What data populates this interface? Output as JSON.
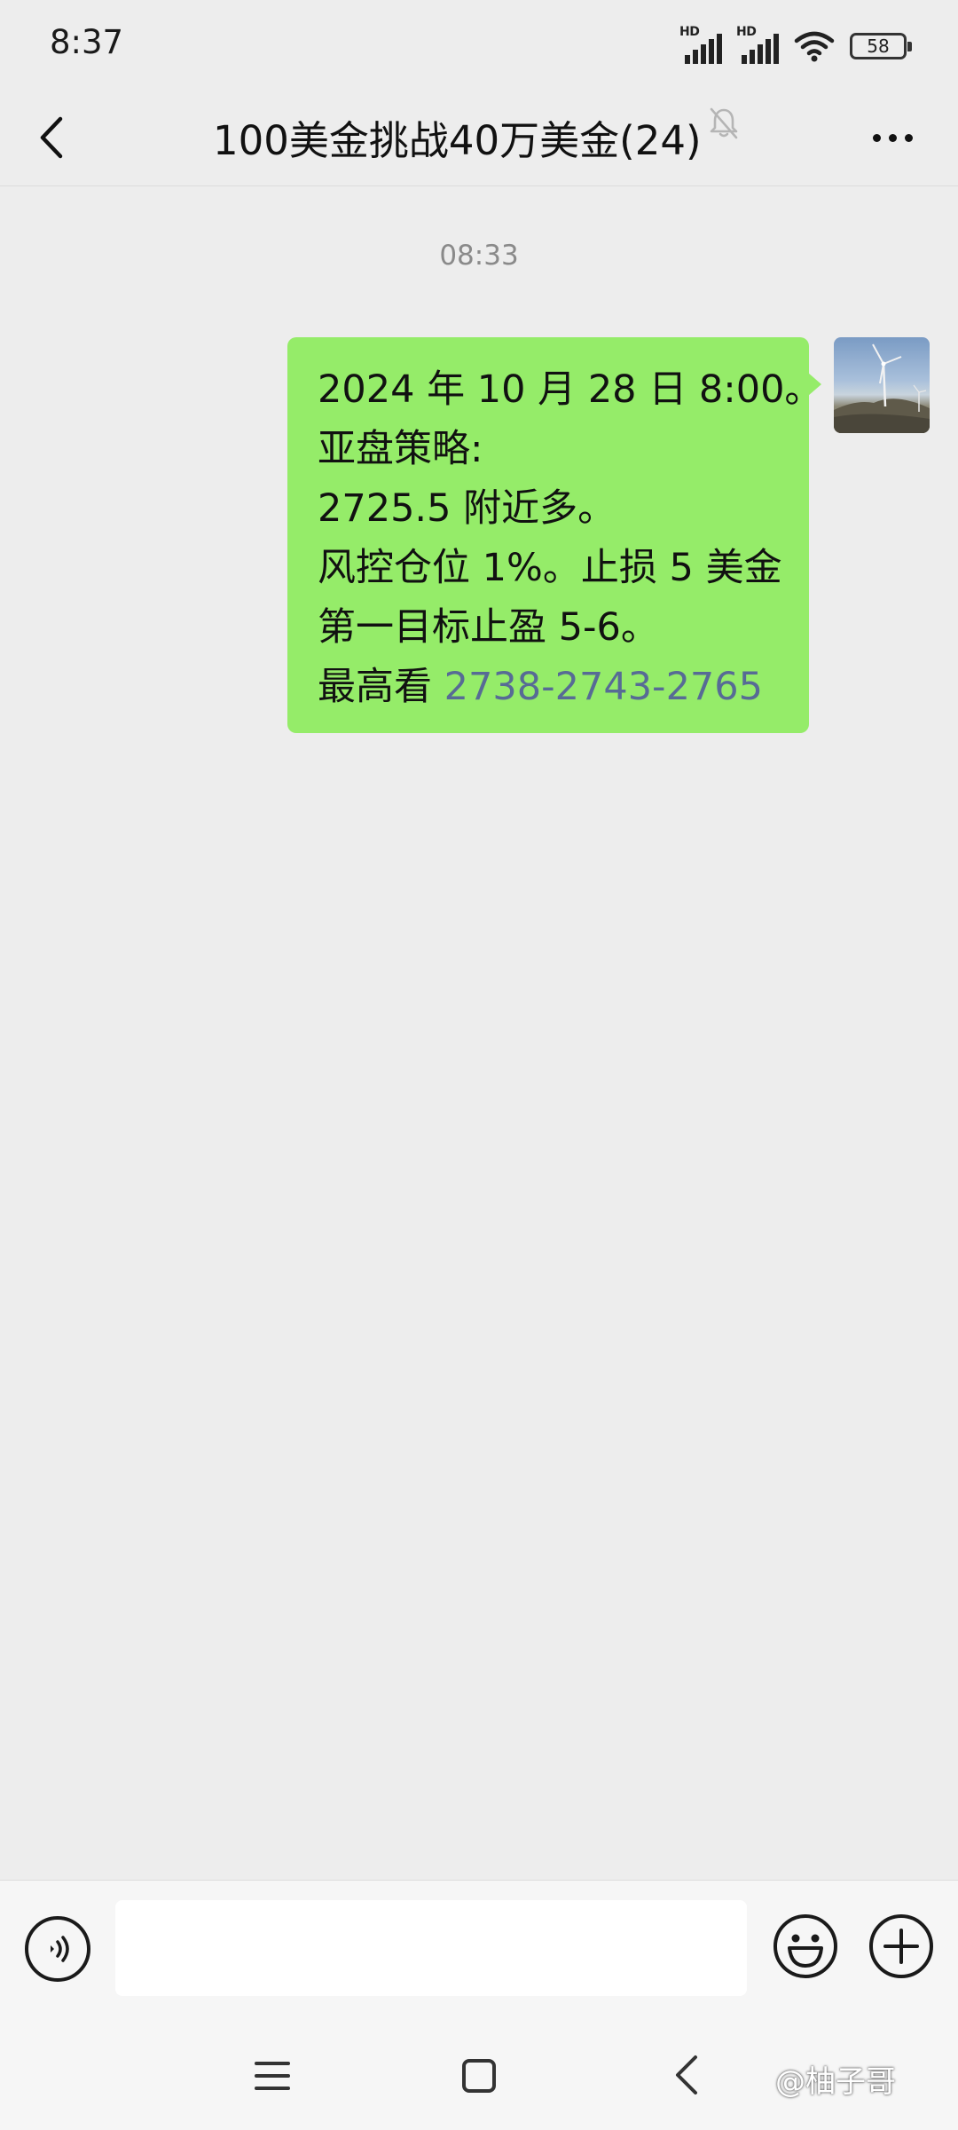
{
  "status_bar": {
    "time": "8:37",
    "signal_1_label": "HD",
    "signal_2_label": "HD",
    "battery_level": "58",
    "icons": [
      "signal-icon",
      "signal-icon",
      "wifi-icon",
      "battery-icon"
    ]
  },
  "header": {
    "back_icon": "chevron-left-icon",
    "title": "100美金挑战40万美金(24)",
    "mute_icon": "bell-off-icon",
    "more_icon": "more-horizontal-icon"
  },
  "chat": {
    "timestamp": "08:33",
    "message": {
      "line_1": "2024 年 10 月 28 日 8:00。",
      "line_2": "亚盘策略:",
      "line_3": "2725.5 附近多。",
      "line_4": "风控仓位 1%。止损 5 美金",
      "line_5": "第一目标止盈 5-6。",
      "line_6_prefix": "最高看 ",
      "line_6_link": "2738-2743-2765"
    },
    "bubble_color": "#95ec69",
    "link_color": "#576b95"
  },
  "input_bar": {
    "voice_icon": "voice-icon",
    "text_value": "",
    "emoji_icon": "emoji-icon",
    "plus_icon": "plus-circle-icon"
  },
  "nav_bar": {
    "icons": [
      "menu-icon",
      "home-icon",
      "back-icon"
    ],
    "watermark": "@柚子哥"
  }
}
